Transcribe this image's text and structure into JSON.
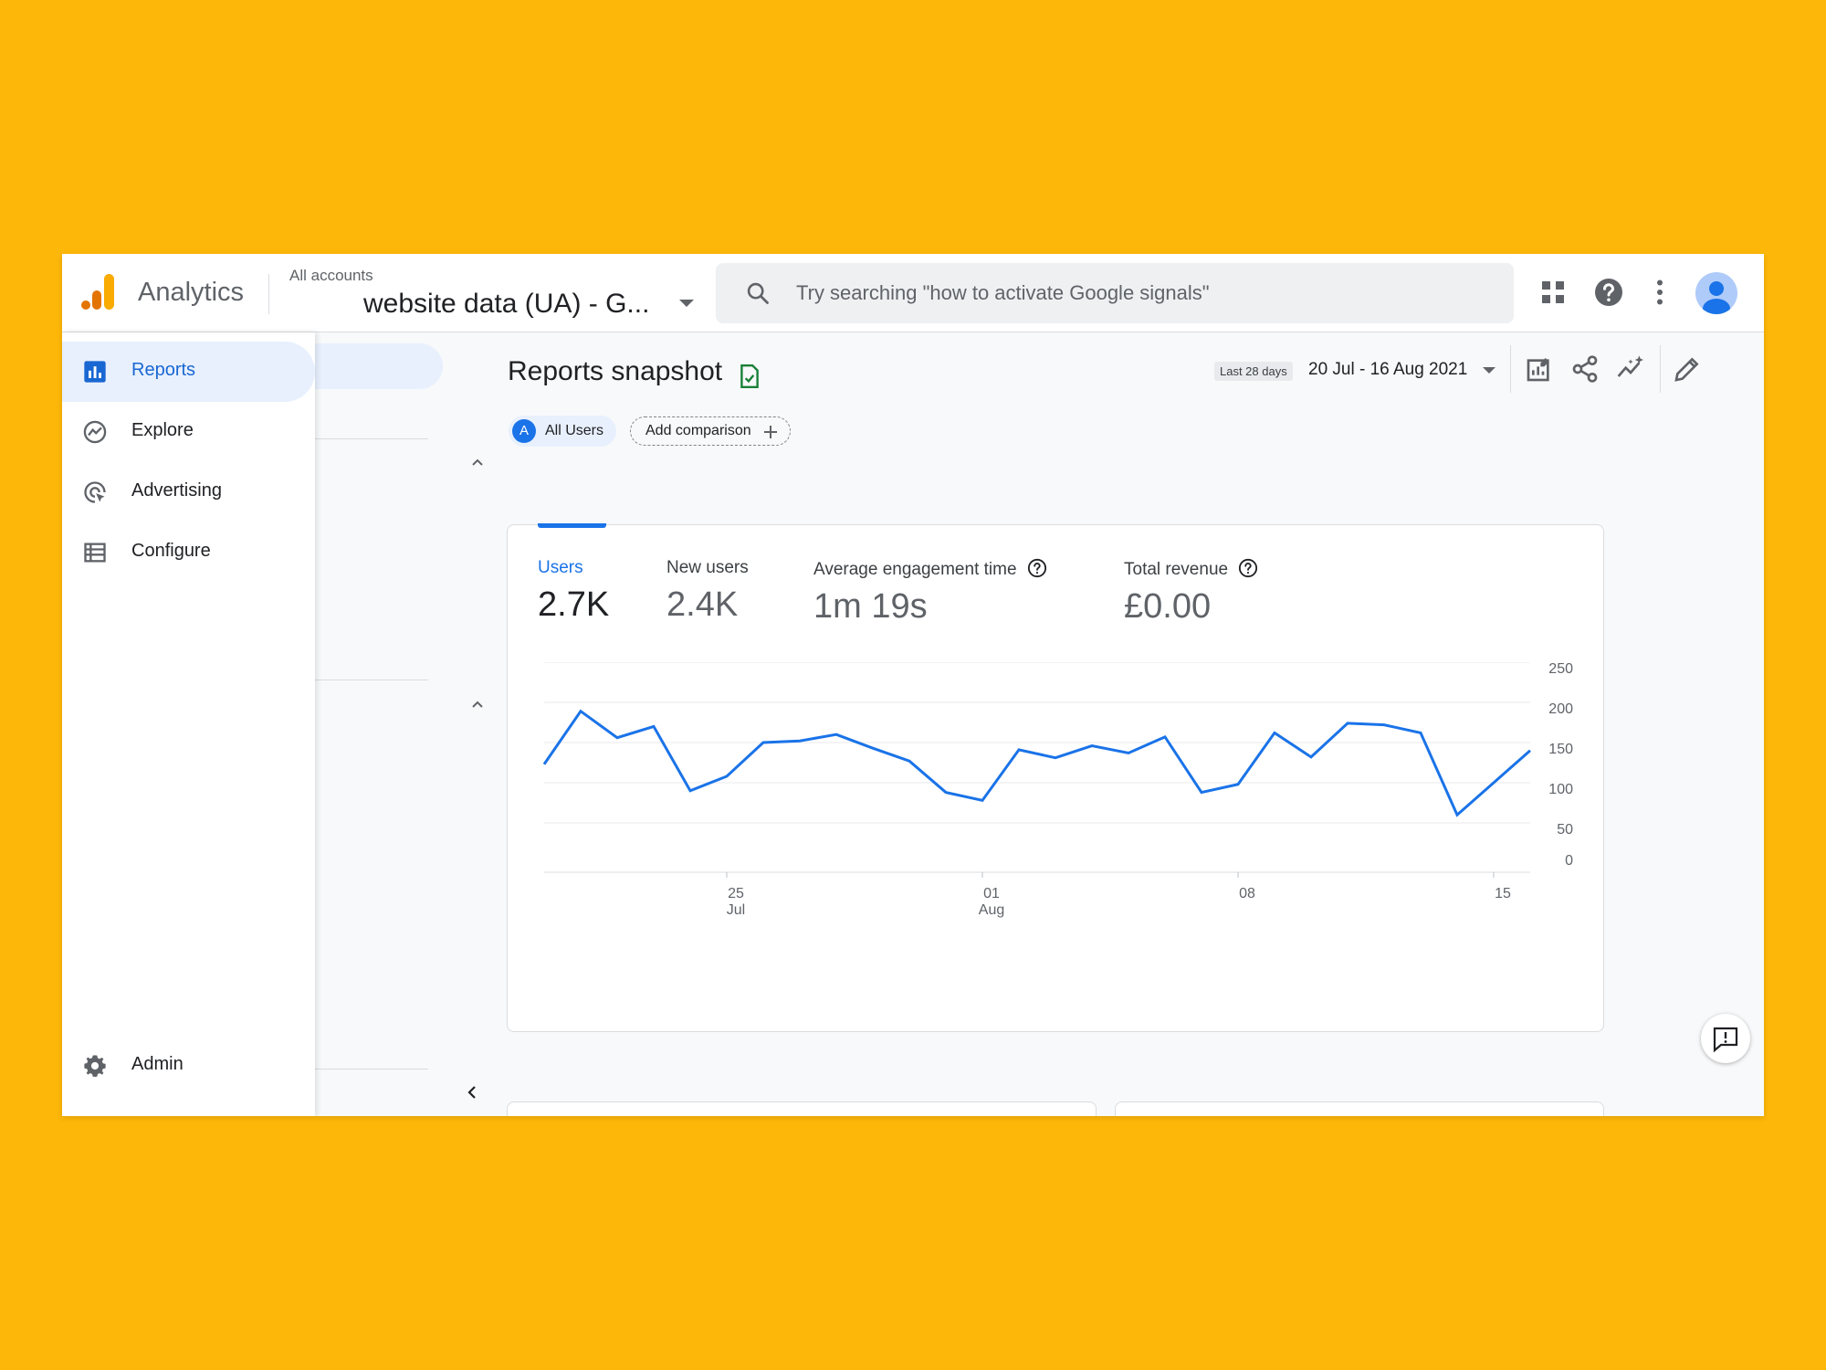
{
  "app": {
    "name": "Analytics",
    "account_label": "All accounts",
    "account_name": "website data (UA) - G...",
    "search_placeholder": "Try searching \"how to activate Google signals\""
  },
  "nav": {
    "items": [
      {
        "label": "Reports",
        "icon": "reports-icon"
      },
      {
        "label": "Explore",
        "icon": "explore-icon"
      },
      {
        "label": "Advertising",
        "icon": "advertising-icon"
      },
      {
        "label": "Configure",
        "icon": "configure-icon"
      }
    ],
    "admin_label": "Admin"
  },
  "page": {
    "title": "Reports snapshot",
    "chips": {
      "all_users_letter": "A",
      "all_users": "All Users",
      "add_comparison": "Add comparison"
    },
    "date_badge": "Last 28 days",
    "date_range": "20 Jul - 16 Aug 2021"
  },
  "metrics": [
    {
      "label": "Users",
      "value": "2.7K",
      "selected": true
    },
    {
      "label": "New users",
      "value": "2.4K",
      "selected": false
    },
    {
      "label": "Average engagement time",
      "value": "1m 19s",
      "selected": false
    },
    {
      "label": "Total revenue",
      "value": "£0.00",
      "selected": false
    }
  ],
  "colors": {
    "accent": "#1A73E8",
    "background": "#FDB709",
    "logo_orange": "#F9AB00",
    "logo_dark": "#E37400"
  },
  "chart_data": {
    "type": "line",
    "series": [
      {
        "values": [
          123,
          189,
          156,
          170,
          90,
          108,
          150,
          152,
          160,
          143,
          127,
          88,
          78,
          141,
          131,
          146,
          137,
          157,
          88,
          98,
          162,
          132,
          174,
          172,
          162,
          60,
          100,
          140
        ]
      }
    ],
    "x_ticks": [
      {
        "index": 5,
        "line1": "25",
        "line2": "Jul"
      },
      {
        "index": 12,
        "line1": "01",
        "line2": "Aug"
      },
      {
        "index": 19,
        "line1": "08",
        "line2": ""
      },
      {
        "index": 26,
        "line1": "15",
        "line2": ""
      }
    ],
    "y_ticks": [
      "250",
      "200",
      "150",
      "100",
      "50",
      "0"
    ],
    "ylim": [
      0,
      250
    ],
    "grid": true
  }
}
